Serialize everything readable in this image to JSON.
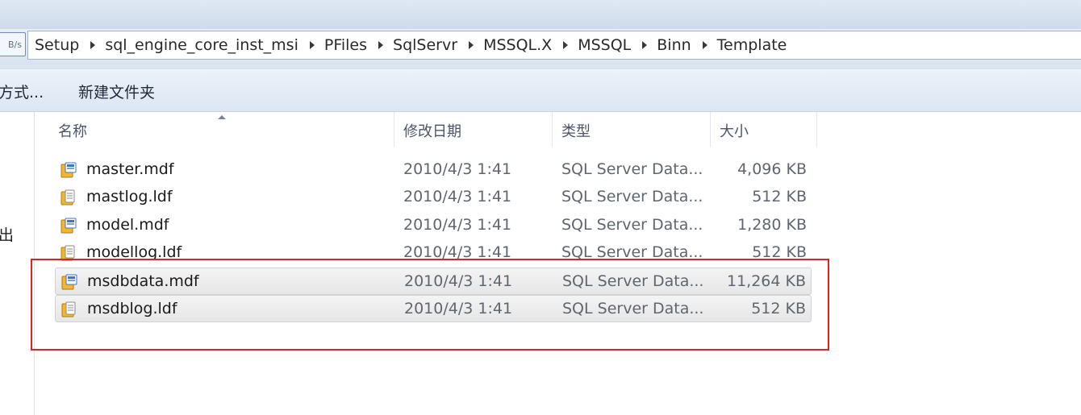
{
  "address": {
    "speed_fragment": "B/s",
    "crumbs": [
      "Setup",
      "sql_engine_core_inst_msi",
      "PFiles",
      "SqlServr",
      "MSSQL.X",
      "MSSQL",
      "Binn",
      "Template"
    ]
  },
  "toolbar": {
    "open_with_fragment": "方式...",
    "new_folder": "新建文件夹"
  },
  "nav": {
    "fragment": "出"
  },
  "columns": {
    "name": "名称",
    "date": "修改日期",
    "type": "类型",
    "size": "大小"
  },
  "files": [
    {
      "name": "master.mdf",
      "date": "2010/4/3 1:41",
      "type": "SQL Server Data...",
      "size": "4,096 KB",
      "icon": "mdf-file-icon"
    },
    {
      "name": "mastlog.ldf",
      "date": "2010/4/3 1:41",
      "type": "SQL Server Data...",
      "size": "512 KB",
      "icon": "ldf-file-icon"
    },
    {
      "name": "model.mdf",
      "date": "2010/4/3 1:41",
      "type": "SQL Server Data...",
      "size": "1,280 KB",
      "icon": "mdf-file-icon"
    },
    {
      "name": "modellog.ldf",
      "date": "2010/4/3 1:41",
      "type": "SQL Server Data...",
      "size": "512 KB",
      "icon": "ldf-file-icon"
    },
    {
      "name": "msdbdata.mdf",
      "date": "2010/4/3 1:41",
      "type": "SQL Server Data...",
      "size": "11,264 KB",
      "icon": "mdf-file-icon"
    },
    {
      "name": "msdblog.ldf",
      "date": "2010/4/3 1:41",
      "type": "SQL Server Data...",
      "size": "512 KB",
      "icon": "ldf-file-icon"
    }
  ],
  "selected_rows": [
    "msdbdata.mdf",
    "msdblog.ldf"
  ],
  "colors": {
    "highlight_box": "#e02222",
    "icon_gold": "#e8a317",
    "icon_blue": "#3d74c6"
  }
}
